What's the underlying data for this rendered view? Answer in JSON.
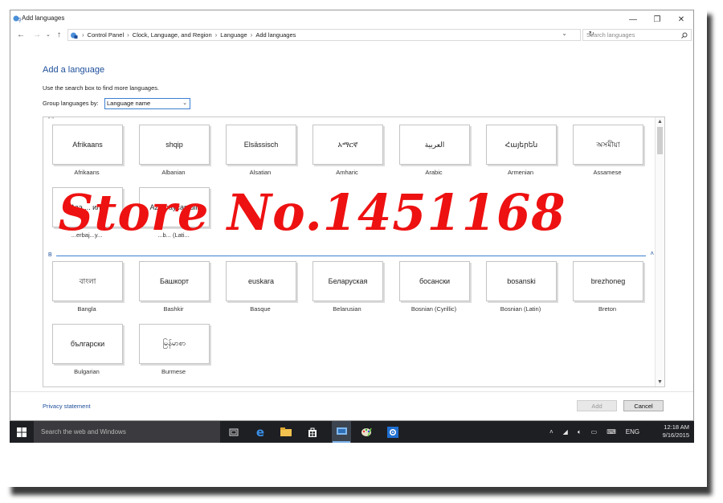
{
  "window": {
    "title": "Add languages",
    "controls": {
      "minimize": "—",
      "restore": "❐",
      "close": "✕"
    }
  },
  "address_bar": {
    "breadcrumbs": [
      "Control Panel",
      "Clock, Language, and Region",
      "Language",
      "Add languages"
    ],
    "search_placeholder": "Search languages"
  },
  "main": {
    "heading": "Add a language",
    "hint": "Use the search box to find more languages.",
    "group_label": "Group languages by:",
    "group_value": "Language name",
    "section_letter": "B",
    "tiles_row1": [
      {
        "native": "Afrikaans",
        "english": "Afrikaans"
      },
      {
        "native": "shqip",
        "english": "Albanian"
      },
      {
        "native": "Elsässisch",
        "english": "Alsatian"
      },
      {
        "native": "አማርኛ",
        "english": "Amharic"
      },
      {
        "native": "العربية",
        "english": "Arabic"
      },
      {
        "native": "Հայերեն",
        "english": "Armenian"
      },
      {
        "native": "অসমীয়া",
        "english": "Assamese"
      }
    ],
    "tiles_row2": [
      {
        "native": "Азə ... или",
        "english": "...erbaj...y..."
      },
      {
        "native": "Azərbaycan dili",
        "english": "...b... (Lati..."
      }
    ],
    "tiles_row3": [
      {
        "native": "বাংলা",
        "english": "Bangla"
      },
      {
        "native": "Башкорт",
        "english": "Bashkir"
      },
      {
        "native": "euskara",
        "english": "Basque"
      },
      {
        "native": "Беларуская",
        "english": "Belarusian"
      },
      {
        "native": "босански",
        "english": "Bosnian (Cyrillic)"
      },
      {
        "native": "bosanski",
        "english": "Bosnian (Latin)"
      },
      {
        "native": "brezhoneg",
        "english": "Breton"
      }
    ],
    "tiles_row4": [
      {
        "native": "български",
        "english": "Bulgarian"
      },
      {
        "native": "မြန်မာစာ",
        "english": "Burmese"
      }
    ]
  },
  "footer": {
    "privacy": "Privacy statement",
    "add_button": "Add",
    "cancel_button": "Cancel"
  },
  "taskbar": {
    "search_placeholder": "Search the web and Windows",
    "language": "ENG",
    "time": "12:18 AM",
    "date": "9/16/2015"
  },
  "watermark": "Store No.1451168",
  "colors": {
    "accent": "#1c4d9a",
    "watermark": "#ee1111",
    "taskbar": "#1e1f23"
  }
}
